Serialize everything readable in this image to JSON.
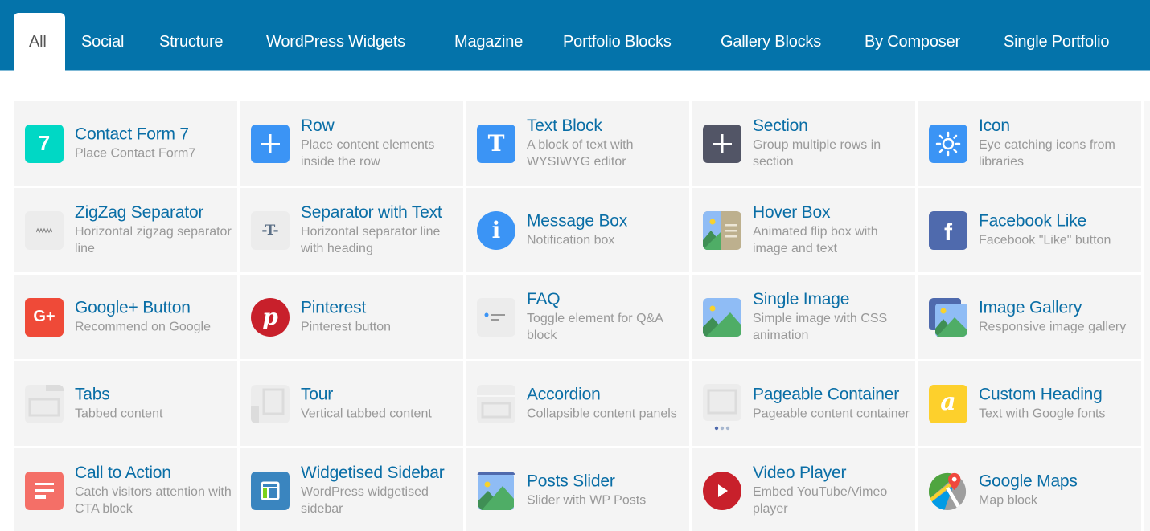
{
  "tabs": [
    {
      "label": "All",
      "active": true
    },
    {
      "label": "Social"
    },
    {
      "label": "Structure"
    },
    {
      "label": "WordPress Widgets"
    },
    {
      "label": "Magazine"
    },
    {
      "label": "Portfolio Blocks"
    },
    {
      "label": "Gallery Blocks"
    },
    {
      "label": "By Composer"
    },
    {
      "label": "Single Portfolio"
    }
  ],
  "colors": {
    "header_bg": "#0473aa",
    "title_text": "#0a6ea6",
    "desc_text": "#999999",
    "cell_bg": "#f4f4f4"
  },
  "elements": [
    {
      "title": "Contact Form 7",
      "desc": "Place Contact Form7",
      "icon": "contact-form-7-icon"
    },
    {
      "title": "Row",
      "desc": "Place content elements inside the row",
      "icon": "plus-icon"
    },
    {
      "title": "Text Block",
      "desc": "A block of text with WYSIWYG editor",
      "icon": "text-t-icon"
    },
    {
      "title": "Section",
      "desc": "Group multiple rows in section",
      "icon": "section-plus-icon"
    },
    {
      "title": "Icon",
      "desc": "Eye catching icons from libraries",
      "icon": "sun-icon"
    },
    {
      "title": "ZigZag Separator",
      "desc": "Horizontal zigzag separator line",
      "icon": "zigzag-icon"
    },
    {
      "title": "Separator with Text",
      "desc": "Horizontal separator line with heading",
      "icon": "separator-text-icon"
    },
    {
      "title": "Message Box",
      "desc": "Notification box",
      "icon": "info-icon"
    },
    {
      "title": "Hover Box",
      "desc": "Animated flip box with image and text",
      "icon": "hover-box-icon"
    },
    {
      "title": "Facebook Like",
      "desc": "Facebook \"Like\" button",
      "icon": "facebook-icon"
    },
    {
      "title": "Google+ Button",
      "desc": "Recommend on Google",
      "icon": "google-plus-icon"
    },
    {
      "title": "Pinterest",
      "desc": "Pinterest button",
      "icon": "pinterest-icon"
    },
    {
      "title": "FAQ",
      "desc": "Toggle element for Q&A block",
      "icon": "faq-icon"
    },
    {
      "title": "Single Image",
      "desc": "Simple image with CSS animation",
      "icon": "image-icon"
    },
    {
      "title": "Image Gallery",
      "desc": "Responsive image gallery",
      "icon": "gallery-icon"
    },
    {
      "title": "Tabs",
      "desc": "Tabbed content",
      "icon": "tabs-icon"
    },
    {
      "title": "Tour",
      "desc": "Vertical tabbed content",
      "icon": "tour-icon"
    },
    {
      "title": "Accordion",
      "desc": "Collapsible content panels",
      "icon": "accordion-icon"
    },
    {
      "title": "Pageable Container",
      "desc": "Pageable content container",
      "icon": "pageable-icon"
    },
    {
      "title": "Custom Heading",
      "desc": "Text with Google fonts",
      "icon": "custom-heading-icon"
    },
    {
      "title": "Call to Action",
      "desc": "Catch visitors attention with CTA block",
      "icon": "cta-icon"
    },
    {
      "title": "Widgetised Sidebar",
      "desc": "WordPress widgetised sidebar",
      "icon": "sidebar-icon"
    },
    {
      "title": "Posts Slider",
      "desc": "Slider with WP Posts",
      "icon": "posts-slider-icon"
    },
    {
      "title": "Video Player",
      "desc": "Embed YouTube/Vimeo player",
      "icon": "play-icon"
    },
    {
      "title": "Google Maps",
      "desc": "Map block",
      "icon": "map-icon"
    }
  ]
}
